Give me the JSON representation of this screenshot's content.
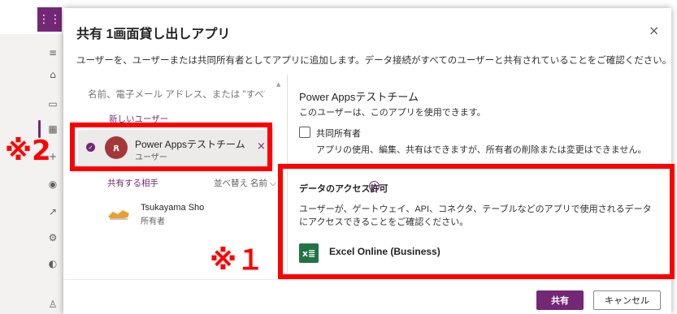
{
  "dialog": {
    "title": "共有 1画面貸し出しアプリ",
    "close_glyph": "×",
    "subtitle": "ユーザーを、ユーザーまたは共同所有者としてアプリに追加します。データ接続がすべてのユーザーと共有されていることをご確認ください。"
  },
  "left": {
    "search_placeholder": "名前、電子メール アドレス、または \"すべて\"",
    "section_new": "新しいユーザー",
    "selected_user": {
      "name": "Power Appsテストチーム",
      "role": "ユーザー",
      "avatar_glyph": "ጸ",
      "remove_glyph": "×"
    },
    "share_with": "共有する相手",
    "sort_label": "並べ替え 名前",
    "owner": {
      "name": "Tsukayama Sho",
      "role": "所有者"
    }
  },
  "right": {
    "team_title": "Power Appsテストチーム",
    "team_desc": "このユーザーは、このアプリを使用できます。",
    "coowner_label": "共同所有者",
    "coowner_desc": "アプリの使用、編集、共有はできますが、所有者の削除または変更はできません。",
    "access_title": "データのアクセス許可",
    "access_desc": "ユーザーが、ゲートウェイ、API、コネクタ、テーブルなどのアプリで使用されるデータにアクセスできることをご確認ください。",
    "connector_label": "Excel Online (Business)"
  },
  "footer": {
    "share_button": "共有",
    "cancel_button": "キャンセル"
  },
  "annotations": {
    "mark_1": "※１",
    "mark_2": "※2"
  },
  "colors": {
    "accent": "#742774",
    "highlight": "#ff0000",
    "excel": "#217346",
    "avatar": "#a4373a"
  }
}
